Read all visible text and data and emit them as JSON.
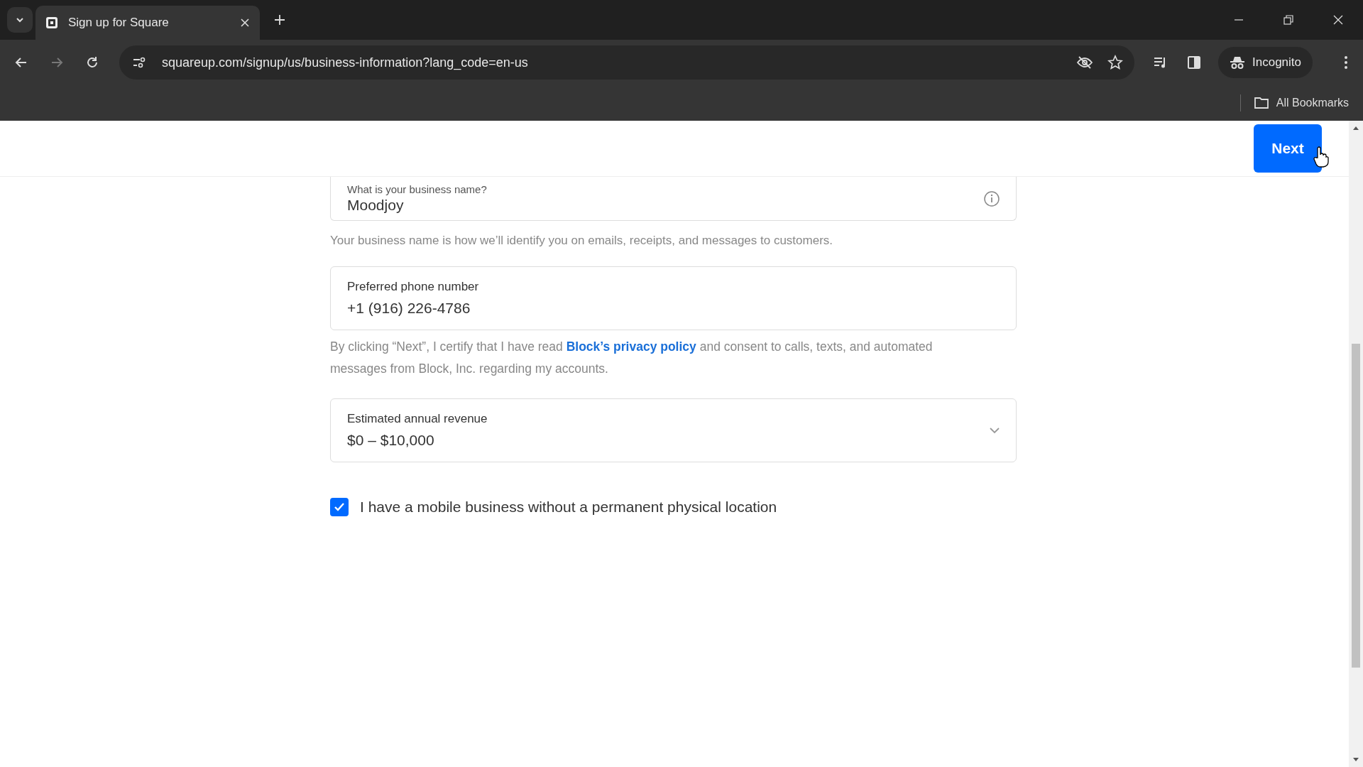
{
  "browser": {
    "tab_title": "Sign up for Square",
    "url": "squareup.com/signup/us/business-information?lang_code=en-us",
    "profile": "Incognito",
    "bookmarks": "All Bookmarks"
  },
  "header": {
    "next_button": "Next"
  },
  "form": {
    "business_name": {
      "label": "What is your business name?",
      "value": "Moodjoy",
      "help": "Your business name is how we’ll identify you on emails, receipts, and messages to customers."
    },
    "phone": {
      "label": "Preferred phone number",
      "value": "+1 (916) 226-4786"
    },
    "consent": {
      "before": "By clicking “Next”, I certify that I have read",
      "link": "Block’s privacy policy",
      "after": "and consent to calls, texts, and automated messages from Block, Inc. regarding my accounts."
    },
    "revenue": {
      "label": "Estimated annual revenue",
      "value": "$0 – $10,000"
    },
    "mobile_business": {
      "label": "I have a mobile business without a permanent physical location",
      "checked": true
    }
  }
}
